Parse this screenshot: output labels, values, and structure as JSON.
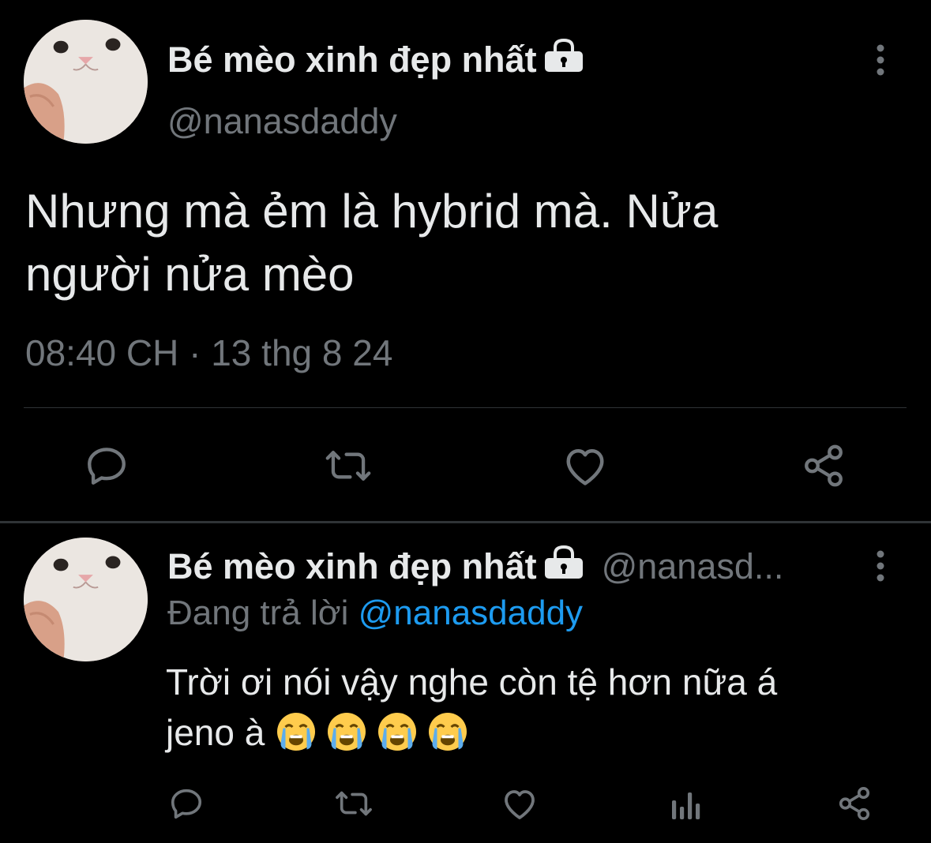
{
  "main_tweet": {
    "display_name": "Bé mèo xinh đẹp nhất",
    "handle": "@nanasdaddy",
    "text_line1": "Nhưng mà ẻm là hybrid mà. Nửa",
    "text_line2": "người nửa mèo",
    "timestamp": "08:40 CH · 13 thg 8 24",
    "icons": {
      "avatar": "cat-avatar",
      "lock": "lock-icon",
      "more": "more-vertical-icon",
      "reply": "reply-icon",
      "retweet": "retweet-icon",
      "like": "heart-icon",
      "share": "share-icon"
    }
  },
  "reply_tweet": {
    "display_name": "Bé mèo xinh đẹp nhất",
    "handle": "@nanasd...",
    "replying_to_label": "Đang trả lời",
    "replying_to_handle": "@nanasdaddy",
    "text_line1": "Trời ơi nói vậy nghe còn tệ hơn nữa á",
    "text_line2": "jeno à",
    "emojis": [
      "loudly-crying-face",
      "loudly-crying-face",
      "loudly-crying-face",
      "loudly-crying-face"
    ],
    "icons": {
      "reply": "reply-icon",
      "retweet": "retweet-icon",
      "like": "heart-icon",
      "analytics": "analytics-icon",
      "share": "share-icon"
    }
  },
  "colors": {
    "background": "#000000",
    "text": "#e7e9ea",
    "secondary": "#71767b",
    "link": "#1d9bf0",
    "divider": "#2f3336"
  }
}
